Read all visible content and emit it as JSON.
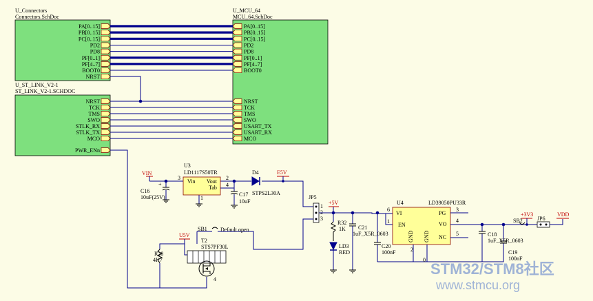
{
  "sheets": {
    "connectors": {
      "designator": "U_Connectors",
      "file": "Connectors.SchDoc",
      "ports": [
        "PA[0..15]",
        "PB[0..15]",
        "PC[0..15]",
        "PD2",
        "PD8",
        "PF[0..1]",
        "PF[4..7]",
        "BOOT0",
        "NRST"
      ]
    },
    "mcu": {
      "designator": "U_MCU_64",
      "file": "MCU_64.SchDoc",
      "ports": [
        "PA[0..15]",
        "PB[0..15]",
        "PC[0..15]",
        "PD2",
        "PD8",
        "PF[0..1]",
        "PF[4..7]",
        "BOOT0",
        "NRST",
        "TCK",
        "TMS",
        "SWO",
        "USART_TX",
        "USART_RX",
        "MCO"
      ]
    },
    "stlink": {
      "designator": "U_ST_LINK_V2-1",
      "file": "ST_LINK_V2-1.SCHDOC",
      "ports": [
        "NRST",
        "TCK",
        "TMS",
        "SWO",
        "STLK_RX",
        "STLK_TX",
        "MCO",
        "PWR_ENn"
      ]
    }
  },
  "components": {
    "u3": {
      "ref": "U3",
      "part": "LD1117S50TR",
      "pin_vin": "Vin",
      "pin_vout": "Vout",
      "pin_tab": "Tab",
      "p3": "3",
      "p2": "2",
      "p4": "4",
      "p1": "1"
    },
    "c16": {
      "ref": "C16",
      "value": "10uF(25V)"
    },
    "c17": {
      "ref": "C17",
      "value": "10uF"
    },
    "d4": {
      "ref": "D4",
      "part": "STPS2L30A"
    },
    "jp5": {
      "ref": "JP5",
      "p1": "1",
      "p2": "2",
      "p3": "3"
    },
    "r32": {
      "ref": "R32",
      "value": "1K"
    },
    "ld3": {
      "ref": "LD3",
      "color": "RED"
    },
    "c21": {
      "ref": "C21",
      "value": "1uF_X5R_0603"
    },
    "c20": {
      "ref": "C20",
      "value": "100nF"
    },
    "u4": {
      "ref": "U4",
      "part": "LD39050PU33R",
      "pins_left": [
        "VI",
        "EN"
      ],
      "pins_right": [
        "PG",
        "VO",
        "NC"
      ],
      "pins_bottom": [
        "GND",
        "GND"
      ],
      "nums": [
        "6",
        "1",
        "3",
        "4",
        "5",
        "2",
        "0"
      ]
    },
    "c18": {
      "ref": "C18",
      "value": "1uF_X5R_0603"
    },
    "c19": {
      "ref": "C19",
      "value": "100nF"
    },
    "sb2": {
      "ref": "SB2"
    },
    "jp6": {
      "ref": "JP6"
    },
    "r28": {
      "ref": "R28",
      "value": "4K7"
    },
    "sb1": {
      "ref": "SB1",
      "note": "Default open"
    },
    "t2": {
      "ref": "T2",
      "part": "STS7PF30L",
      "n4": "4"
    }
  },
  "nets": {
    "vin": "VIN",
    "e5v": "E5V",
    "p5v": "+5V",
    "u5v": "U5V",
    "v33": "+3V3",
    "vdd": "VDD"
  },
  "watermark": {
    "brand": "STM32/STM8社区",
    "url": "www.stmcu.org"
  },
  "colors": {
    "sheet_fill": "#7ee07e",
    "port_fill": "#ffff99",
    "wire": "#00008c",
    "net_label": "#c00000",
    "background": "#fcfce6"
  }
}
